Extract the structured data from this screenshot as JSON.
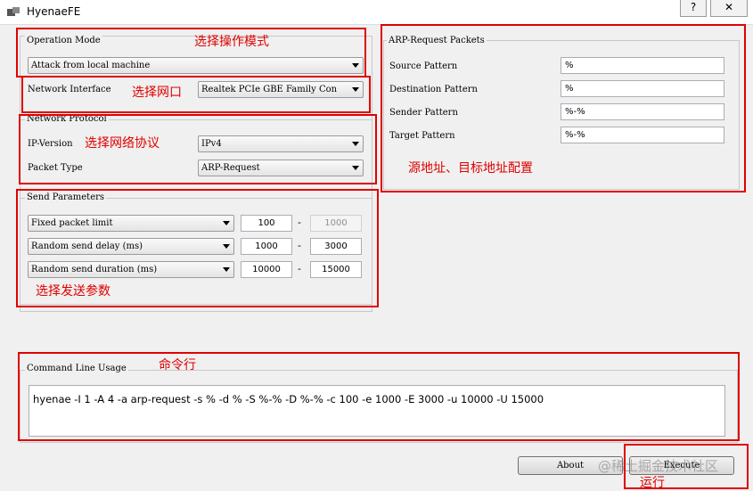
{
  "window": {
    "title": "HyenaeFE",
    "help_label": "?",
    "close_label": "✕"
  },
  "operation_mode": {
    "group_label": "Operation Mode",
    "value": "Attack from local machine"
  },
  "network_interface": {
    "label": "Network Interface",
    "value": "Realtek PCIe GBE Family Con"
  },
  "network_protocol": {
    "group_label": "Network Protocol",
    "ip_version_label": "IP-Version",
    "ip_version_value": "IPv4",
    "packet_type_label": "Packet Type",
    "packet_type_value": "ARP-Request"
  },
  "send_parameters": {
    "group_label": "Send Parameters",
    "rows": [
      {
        "option": "Fixed packet limit",
        "min": "100",
        "max": "1000",
        "max_disabled": true
      },
      {
        "option": "Random send delay (ms)",
        "min": "1000",
        "max": "3000",
        "max_disabled": false
      },
      {
        "option": "Random send duration (ms)",
        "min": "10000",
        "max": "15000",
        "max_disabled": false
      }
    ],
    "separator": "-"
  },
  "arp_packets": {
    "group_label": "ARP-Request Packets",
    "rows": [
      {
        "label": "Source Pattern",
        "value": "%"
      },
      {
        "label": "Destination Pattern",
        "value": "%"
      },
      {
        "label": "Sender Pattern",
        "value": "%-%"
      },
      {
        "label": "Target Pattern",
        "value": "%-%"
      }
    ]
  },
  "command_line": {
    "group_label": "Command Line Usage",
    "value": "hyenae -I 1 -A 4 -a arp-request -s % -d % -S %-% -D %-% -c 100 -e 1000 -E 3000 -u 10000 -U 15000"
  },
  "buttons": {
    "about": "About",
    "execute": "Execute"
  },
  "annotations": {
    "operation_mode": "选择操作模式",
    "network_interface": "选择网口",
    "network_protocol": "选择网络协议",
    "arp_config": "源地址、目标地址配置",
    "send_params": "选择发送参数",
    "command_line": "命令行",
    "execute": "运行"
  },
  "watermark": "@稀土掘金技术社区",
  "colors": {
    "annotation_red": "#e00000",
    "window_bg": "#f0f0f0"
  }
}
